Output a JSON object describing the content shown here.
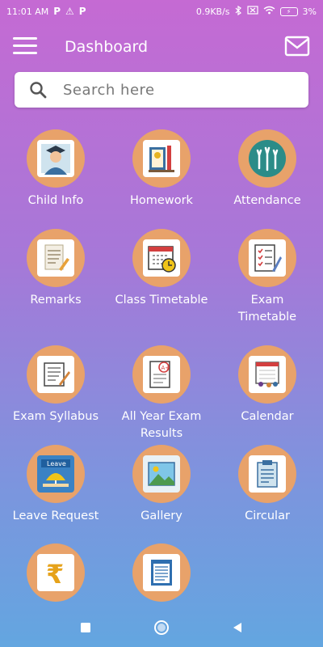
{
  "status": {
    "time": "11:01 AM",
    "left_icons": [
      "P",
      "⚠",
      "P"
    ],
    "speed": "0.9KB/s",
    "battery": "3%"
  },
  "header": {
    "title": "Dashboard"
  },
  "search": {
    "placeholder": "Search here"
  },
  "tiles": [
    {
      "label": "Child Info",
      "icon": "student-avatar-icon"
    },
    {
      "label": "Homework",
      "icon": "homework-books-icon"
    },
    {
      "label": "Attendance",
      "icon": "raised-hands-icon"
    },
    {
      "label": "Remarks",
      "icon": "document-pencil-icon"
    },
    {
      "label": "Class Timetable",
      "icon": "calendar-clock-icon"
    },
    {
      "label": "Exam\nTimetable",
      "icon": "checklist-icon"
    },
    {
      "label": "Exam Syllabus",
      "icon": "syllabus-scroll-icon"
    },
    {
      "label": "All Year Exam\nResults",
      "icon": "graded-paper-icon"
    },
    {
      "label": "Calendar",
      "icon": "calendar-people-icon"
    },
    {
      "label": "Leave Request",
      "icon": "leave-umbrella-icon",
      "badge": "Leave"
    },
    {
      "label": "Gallery",
      "icon": "picture-icon"
    },
    {
      "label": "Circular",
      "icon": "clipboard-icon"
    },
    {
      "label": "",
      "icon": "rupee-icon"
    },
    {
      "label": "",
      "icon": "receipt-icon"
    }
  ],
  "colors": {
    "tile_circle": "#e8a26a",
    "gradient_top": "#c56ad3",
    "gradient_bottom": "#63a6e0"
  }
}
